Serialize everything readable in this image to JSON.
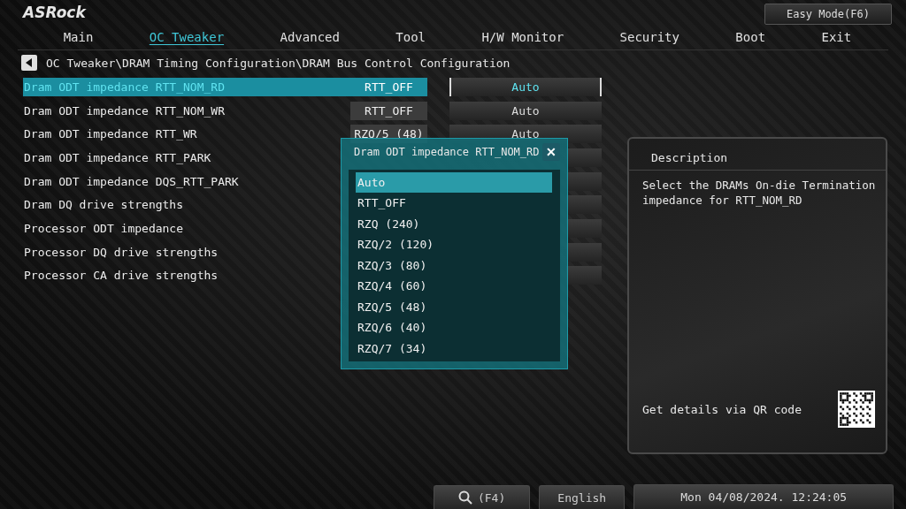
{
  "logo": "ASRock",
  "easy_mode_button": "Easy Mode(F6)",
  "tabs": [
    {
      "label": "Main",
      "selected": false
    },
    {
      "label": "OC Tweaker",
      "selected": true
    },
    {
      "label": "Advanced",
      "selected": false
    },
    {
      "label": "Tool",
      "selected": false
    },
    {
      "label": "H/W Monitor",
      "selected": false
    },
    {
      "label": "Security",
      "selected": false
    },
    {
      "label": "Boot",
      "selected": false
    },
    {
      "label": "Exit",
      "selected": false
    }
  ],
  "breadcrumb": "OC Tweaker\\DRAM Timing Configuration\\DRAM Bus Control Configuration",
  "settings": [
    {
      "label": "Dram ODT impedance RTT_NOM_RD",
      "current": "RTT_OFF",
      "value": "Auto",
      "selected": true
    },
    {
      "label": "Dram ODT impedance RTT_NOM_WR",
      "current": "RTT_OFF",
      "value": "Auto",
      "selected": false
    },
    {
      "label": "Dram ODT impedance RTT_WR",
      "current": "RZQ/5 (48)",
      "value": "Auto",
      "selected": false
    },
    {
      "label": "Dram ODT impedance RTT_PARK",
      "selected": false
    },
    {
      "label": "Dram ODT impedance DQS_RTT_PARK",
      "selected": false
    },
    {
      "label": "Dram DQ drive strengths",
      "selected": false
    },
    {
      "label": "Processor ODT impedance",
      "selected": false
    },
    {
      "label": "Processor DQ drive strengths",
      "selected": false
    },
    {
      "label": "Processor CA drive strengths",
      "selected": false
    }
  ],
  "popup": {
    "title": "Dram ODT impedance RTT_NOM_RD",
    "close": "✕",
    "options": [
      {
        "label": "Auto",
        "selected": true
      },
      {
        "label": "RTT_OFF",
        "selected": false
      },
      {
        "label": "RZQ (240)",
        "selected": false
      },
      {
        "label": "RZQ/2 (120)",
        "selected": false
      },
      {
        "label": "RZQ/3 (80)",
        "selected": false
      },
      {
        "label": "RZQ/4 (60)",
        "selected": false
      },
      {
        "label": "RZQ/5 (48)",
        "selected": false
      },
      {
        "label": "RZQ/6 (40)",
        "selected": false
      },
      {
        "label": "RZQ/7 (34)",
        "selected": false
      }
    ]
  },
  "description": {
    "title": "Description",
    "text": "Select the DRAMs On-die Termination impedance for RTT_NOM_RD",
    "qr_text": "Get details via QR code"
  },
  "status_bar": {
    "search_key": "(F4)",
    "language": "English",
    "datetime": "Mon 04/08/2024. 12:24:05"
  }
}
